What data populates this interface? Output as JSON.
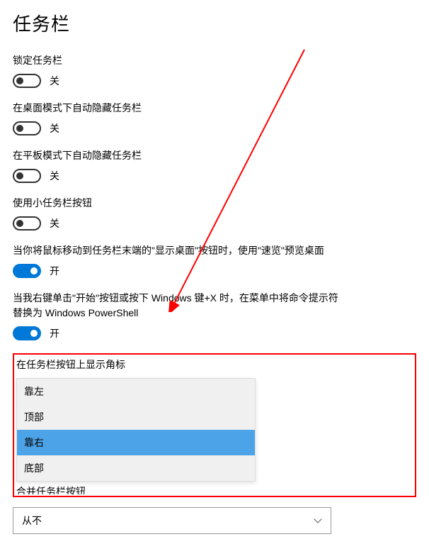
{
  "page": {
    "title": "任务栏"
  },
  "toggles": {
    "lock": {
      "label": "锁定任务栏",
      "state": "关",
      "on": false
    },
    "autoHideDesktop": {
      "label": "在桌面模式下自动隐藏任务栏",
      "state": "关",
      "on": false
    },
    "autoHideTablet": {
      "label": "在平板模式下自动隐藏任务栏",
      "state": "关",
      "on": false
    },
    "smallButtons": {
      "label": "使用小任务栏按钮",
      "state": "关",
      "on": false
    },
    "peek": {
      "label": "当你将鼠标移动到任务栏末端的\"显示桌面\"按钮时，使用\"速览\"预览桌面",
      "state": "开",
      "on": true
    },
    "powershell": {
      "label": "当我右键单击\"开始\"按钮或按下 Windows 键+X 时，在菜单中将命令提示符替换为 Windows PowerShell",
      "state": "开",
      "on": true
    }
  },
  "badge": {
    "label": "在任务栏按钮上显示角标",
    "options": [
      "靠左",
      "顶部",
      "靠右",
      "底部"
    ],
    "selected": "靠右"
  },
  "partial": {
    "text": "合并任务栏按钮"
  },
  "combine": {
    "value": "从不"
  },
  "annotation": {
    "arrow_color": "#ff0000"
  }
}
